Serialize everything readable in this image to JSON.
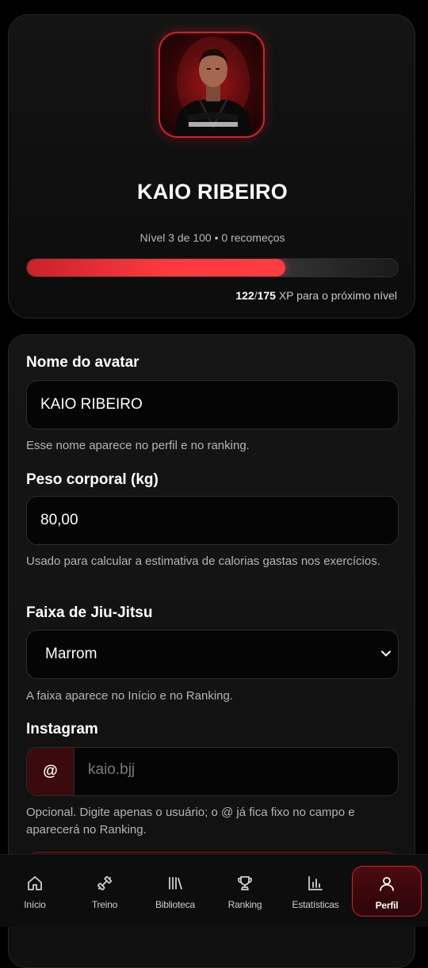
{
  "profile": {
    "name": "KAIO RIBEIRO",
    "level_text": "Nível 3 de 100 • 0 recomeços",
    "xp_current": "122",
    "xp_separator": "/",
    "xp_total": "175",
    "xp_suffix": " XP para o próximo nível",
    "xp_progress": 0.697
  },
  "form": {
    "avatar_name": {
      "label": "Nome do avatar",
      "value": "KAIO RIBEIRO",
      "help": "Esse nome aparece no perfil e no ranking."
    },
    "weight": {
      "label": "Peso corporal (kg)",
      "value": "80,00",
      "help": "Usado para calcular a estimativa de calorias gastas nos exercícios."
    },
    "belt": {
      "label": "Faixa de Jiu-Jitsu",
      "value": "Marrom",
      "help": "A faixa aparece no Início e no Ranking."
    },
    "instagram": {
      "label": "Instagram",
      "prefix": "@",
      "placeholder": "kaio.bjj",
      "help": "Opcional. Digite apenas o usuário; o @ já fica fixo no campo e aparecerá no Ranking."
    }
  },
  "nav": {
    "items": [
      {
        "label": "Início",
        "icon": "home-icon"
      },
      {
        "label": "Treino",
        "icon": "dumbbell-icon"
      },
      {
        "label": "Biblioteca",
        "icon": "library-icon"
      },
      {
        "label": "Ranking",
        "icon": "trophy-icon"
      },
      {
        "label": "Estatísticas",
        "icon": "bar-chart-icon"
      },
      {
        "label": "Perfil",
        "icon": "user-icon",
        "active": true
      }
    ]
  },
  "colors": {
    "accent": "#d6212a",
    "xp_fill": "#ff3a3f",
    "background": "#000000"
  }
}
